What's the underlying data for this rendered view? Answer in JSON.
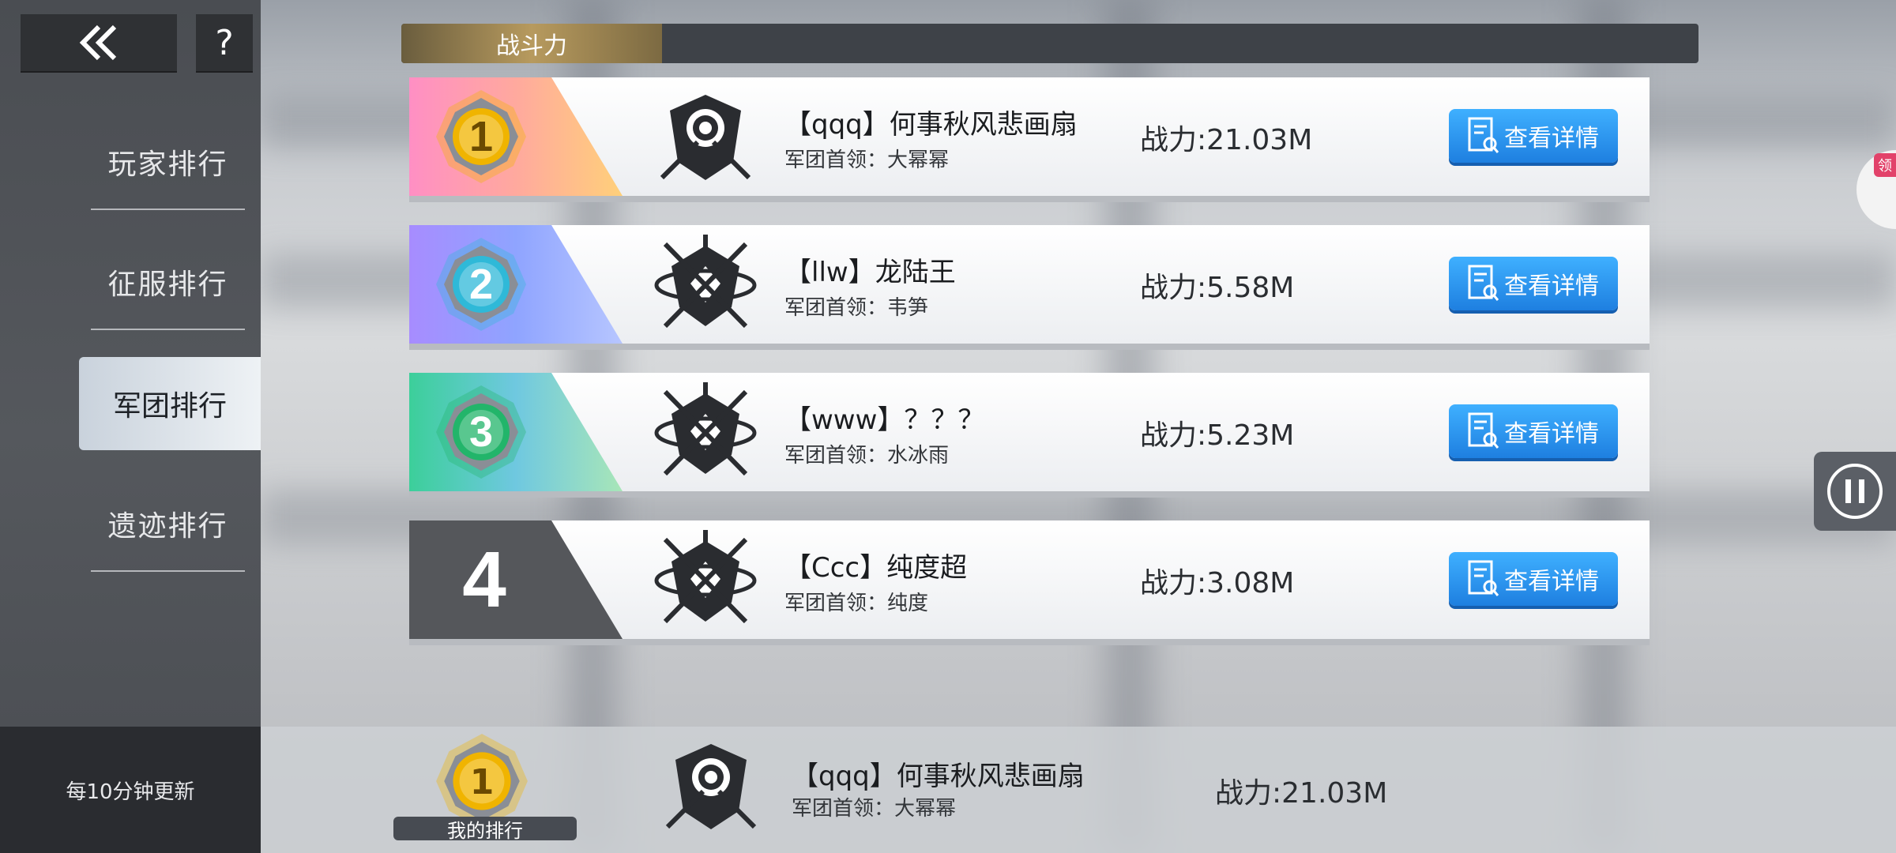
{
  "header": {
    "back_icon": "double-chevron-left-icon",
    "help_label": "?"
  },
  "sidebar": {
    "items": [
      {
        "label": "玩家排行",
        "active": false
      },
      {
        "label": "征服排行",
        "active": false
      },
      {
        "label": "军团排行",
        "active": true
      },
      {
        "label": "遗迹排行",
        "active": false
      }
    ],
    "update_note": "每10分钟更新"
  },
  "title_tab": "战斗力",
  "rows": [
    {
      "rank": 1,
      "rank_style": "gold",
      "name": "【qqq】何事秋风悲画扇",
      "leader": "军团首领：大幂幂",
      "power": "战力:21.03M",
      "button": "查看详情",
      "emblem": "rose"
    },
    {
      "rank": 2,
      "rank_style": "blue",
      "name": "【llw】龙陆王",
      "leader": "军团首领：韦笋",
      "power": "战力:5.58M",
      "button": "查看详情",
      "emblem": "sword"
    },
    {
      "rank": 3,
      "rank_style": "green",
      "name": "【www】？？？",
      "leader": "军团首领：水冰雨",
      "power": "战力:5.23M",
      "button": "查看详情",
      "emblem": "sword"
    },
    {
      "rank": 4,
      "rank_style": "gray",
      "name": "【Ccc】纯度超",
      "leader": "军团首领：纯度",
      "power": "战力:3.08M",
      "button": "查看详情",
      "emblem": "sword"
    }
  ],
  "my_rank": {
    "label": "我的排行",
    "rank": 1,
    "name": "【qqq】何事秋风悲画扇",
    "leader": "军团首领：大幂幂",
    "power": "战力:21.03M"
  },
  "floating": {
    "gift_tag": "领",
    "pause_icon": "pause-icon"
  },
  "colors": {
    "accent_blue": "#1e7fe0",
    "title_gold": "#b79a5e",
    "sidebar_bg": "#4a4d52"
  }
}
